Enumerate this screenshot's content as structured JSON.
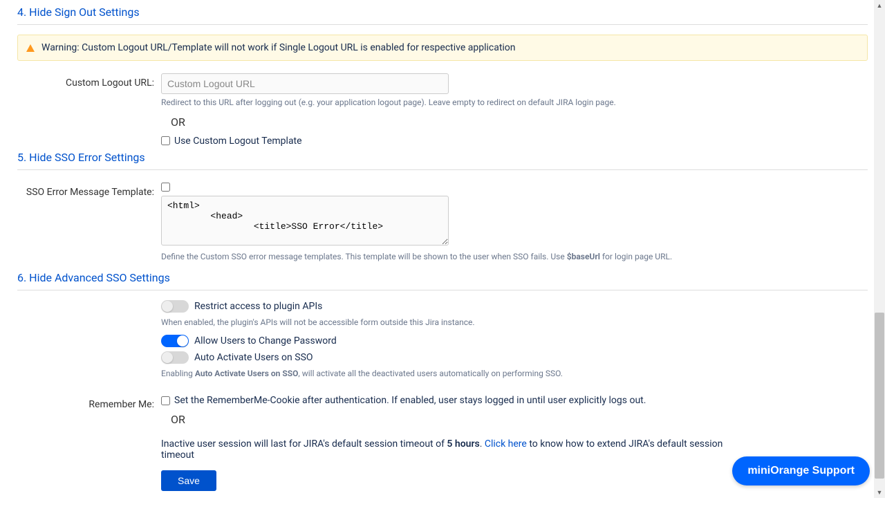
{
  "sections": {
    "signout": {
      "title": "4. Hide Sign Out Settings"
    },
    "ssoerror": {
      "title": "5. Hide SSO Error Settings"
    },
    "advanced": {
      "title": "6. Hide Advanced SSO Settings"
    }
  },
  "warning": {
    "text": "Warning: Custom Logout URL/Template will not work if Single Logout URL is enabled for respective application"
  },
  "logout": {
    "label": "Custom Logout URL:",
    "placeholder": "Custom Logout URL",
    "help": "Redirect to this URL after logging out (e.g. your application logout page). Leave empty to redirect on default JIRA login page.",
    "or": "OR",
    "useTemplate": "Use Custom Logout Template"
  },
  "ssoErrorTpl": {
    "label": "SSO Error Message Template:",
    "value": "<html>\n        <head>\n                <title>SSO Error</title>",
    "help_pre": "Define the Custom SSO error message templates. This template will be shown to the user when SSO fails. Use ",
    "help_bold": "$baseUrl",
    "help_post": " for login page URL."
  },
  "advanced": {
    "restrict": "Restrict access to plugin APIs",
    "restrictHelp": "When enabled, the plugin's APIs will not be accessible form outside this Jira instance.",
    "allowPwd": "Allow Users to Change Password",
    "autoActivate": "Auto Activate Users on SSO",
    "autoActivateHelp_pre": "Enabling ",
    "autoActivateHelp_bold": "Auto Activate Users on SSO",
    "autoActivateHelp_post": ", will activate all the deactivated users automatically on performing SSO.",
    "rememberLabel": "Remember Me:",
    "rememberText": "Set the RememberMe-Cookie after authentication. If enabled, user stays logged in until user explicitly logs out.",
    "or": "OR",
    "session_pre": "Inactive user session will last for JIRA's default session timeout of ",
    "session_bold": "5 hours",
    "session_mid": ". ",
    "session_link": "Click here",
    "session_post": " to know how to extend JIRA's default session timeout"
  },
  "buttons": {
    "save": "Save",
    "support": "miniOrange Support"
  }
}
